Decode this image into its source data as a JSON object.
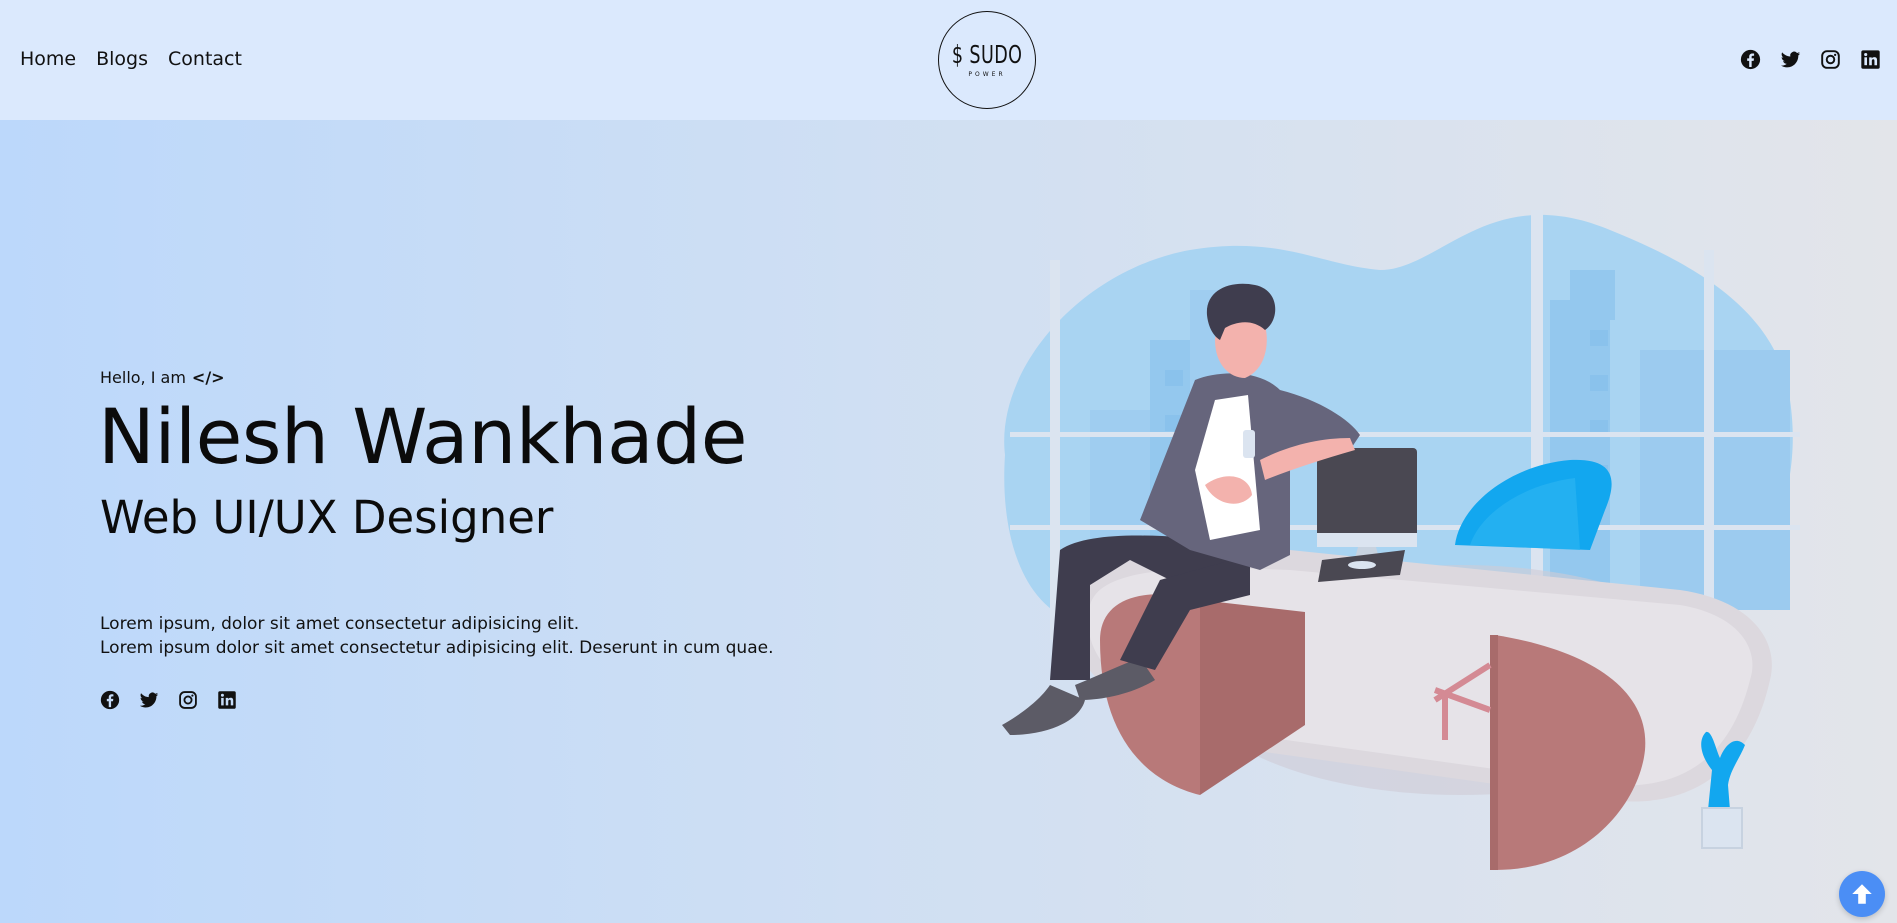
{
  "nav": {
    "home": "Home",
    "blogs": "Blogs",
    "contact": "Contact"
  },
  "logo": {
    "main": "$ SUDO",
    "sub": "POWER"
  },
  "social": {
    "icons": [
      "facebook-icon",
      "twitter-icon",
      "instagram-icon",
      "linkedin-icon"
    ]
  },
  "hero": {
    "greeting": "Hello, I am",
    "code_glyph": "</>",
    "name": "Nilesh Wankhade",
    "role": "Web UI/UX Designer",
    "desc_line1": "Lorem ipsum, dolor sit amet consectetur adipisicing elit.",
    "desc_line2": "Lorem ipsum dolor sit amet consectetur adipisicing elit. Deserunt in cum quae."
  },
  "colors": {
    "header_bg": "#dbe9fd",
    "accent": "#4b8ef5",
    "desk": "#b87979",
    "chair": "#12a7ef"
  }
}
